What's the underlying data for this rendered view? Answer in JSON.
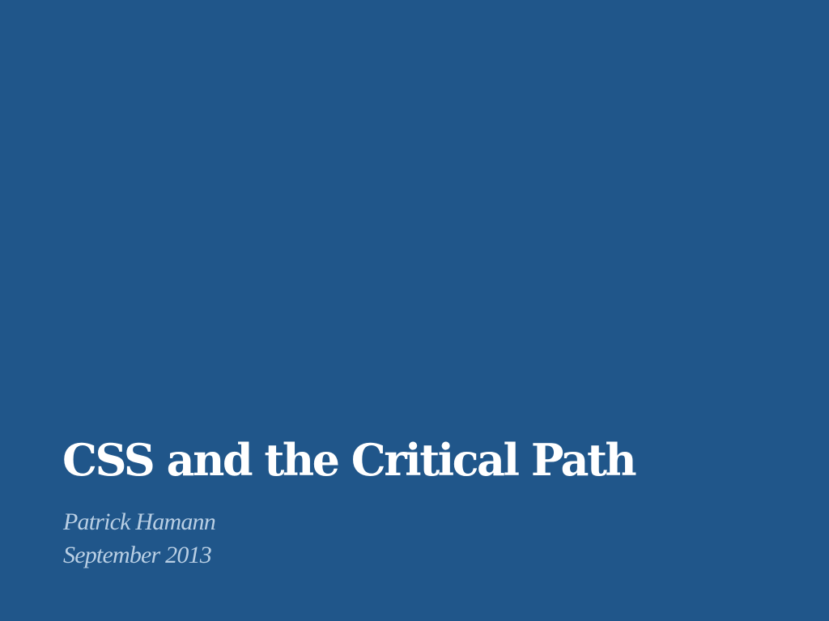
{
  "slide": {
    "title": "CSS and the Critical Path",
    "author": "Patrick Hamann",
    "date": "September 2013",
    "colors": {
      "background": "#20568a",
      "title": "#ffffff",
      "subtitle": "#b9cfe4"
    }
  }
}
